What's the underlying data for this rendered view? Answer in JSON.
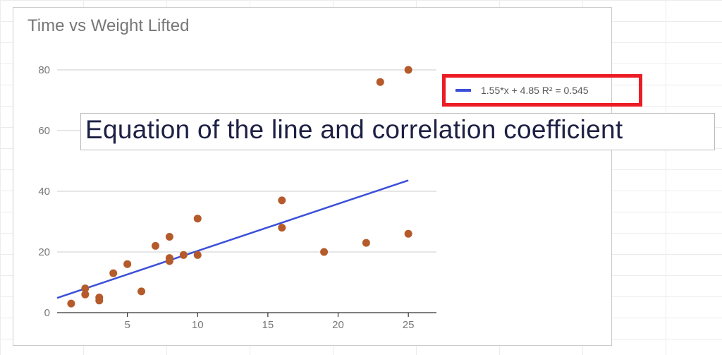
{
  "chart_data": {
    "type": "scatter",
    "title": "Time vs Weight Lifted",
    "xlabel": "",
    "ylabel": "",
    "xlim": [
      0,
      27
    ],
    "ylim": [
      0,
      80
    ],
    "x_ticks": [
      5,
      10,
      15,
      20,
      25
    ],
    "y_ticks": [
      0,
      20,
      40,
      60,
      80
    ],
    "points": [
      {
        "x": 1,
        "y": 3
      },
      {
        "x": 2,
        "y": 6
      },
      {
        "x": 2,
        "y": 8
      },
      {
        "x": 3,
        "y": 5
      },
      {
        "x": 3,
        "y": 4
      },
      {
        "x": 4,
        "y": 13
      },
      {
        "x": 5,
        "y": 16
      },
      {
        "x": 6,
        "y": 7
      },
      {
        "x": 7,
        "y": 22
      },
      {
        "x": 8,
        "y": 17
      },
      {
        "x": 8,
        "y": 18
      },
      {
        "x": 8,
        "y": 25
      },
      {
        "x": 9,
        "y": 19
      },
      {
        "x": 10,
        "y": 19
      },
      {
        "x": 10,
        "y": 31
      },
      {
        "x": 16,
        "y": 28
      },
      {
        "x": 16,
        "y": 37
      },
      {
        "x": 19,
        "y": 20
      },
      {
        "x": 22,
        "y": 23
      },
      {
        "x": 23,
        "y": 76
      },
      {
        "x": 25,
        "y": 80
      },
      {
        "x": 25,
        "y": 26
      }
    ],
    "trendline": {
      "slope": 1.55,
      "intercept": 4.85,
      "r_squared": 0.545
    },
    "legend_text": "1.55*x + 4.85 R² = 0.545"
  },
  "annotation_text": "Equation of the line and correlation coefficient"
}
